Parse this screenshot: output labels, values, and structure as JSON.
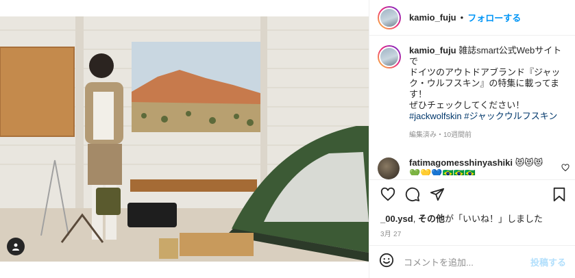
{
  "post": {
    "username": "kamio_fuju",
    "follow_label": "フォローする",
    "separator": "•",
    "caption_lines": [
      "雑誌smart公式Webサイト",
      "で",
      "ドイツのアウトドアブランド『ジャッ",
      "ク・ウルフスキン』の特集に載ってま",
      "す！",
      "ぜひチェックしてください！"
    ],
    "hashtags": [
      "#jackwolfskin",
      "#ジャックウルフスキン"
    ],
    "caption_meta": "編集済み・10週間前",
    "comment": {
      "username": "fatimagomesshinyashiki",
      "emoji_line1": "😻😻😻",
      "emoji_line2": "💚💛💙🇧🇷🇧🇷🇧🇷"
    },
    "likes": {
      "user": "_00.ysd",
      "others_bold": "その他",
      "suffix": "が「いいね！」しました"
    },
    "date": "3月 27",
    "add_comment_placeholder": "コメントを追加...",
    "post_label": "投稿する"
  },
  "icons": [
    "heart-icon",
    "comment-icon",
    "share-icon",
    "bookmark-icon",
    "emoji-icon",
    "user-tag-icon"
  ],
  "colors": {
    "accent": "#0095f6",
    "post_disabled": "#b2dffc",
    "text": "#262626",
    "muted": "#8e8e8e",
    "hashtag": "#00376b"
  }
}
